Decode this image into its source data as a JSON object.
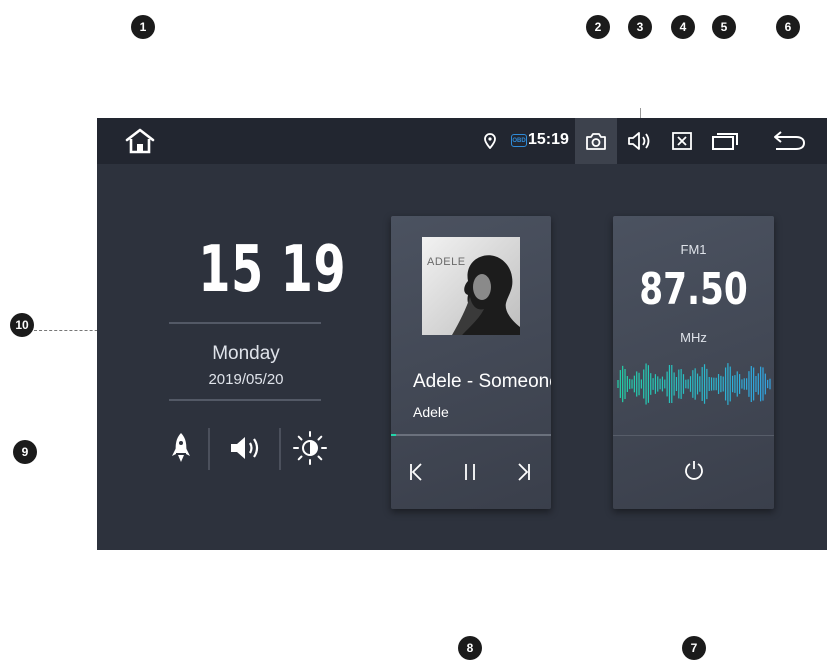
{
  "callouts": [
    "1",
    "2",
    "3",
    "4",
    "5",
    "6",
    "7",
    "8",
    "9",
    "10"
  ],
  "statusbar": {
    "home_icon": "home-icon",
    "location_icon": "location-pin-icon",
    "obd_badge": "OBD",
    "time": "15:19",
    "camera_icon": "camera-icon",
    "volume_icon": "volume-icon",
    "close_icon": "close-icon",
    "recent_apps_icon": "recent-apps-icon",
    "back_icon": "back-icon"
  },
  "clock": {
    "time": "15 19",
    "day": "Monday",
    "date": "2019/05/20"
  },
  "quick_buttons": [
    "rocket-icon",
    "speaker-icon",
    "brightness-icon"
  ],
  "music": {
    "album_art_text": "ADELE",
    "song": "Adele - Someone Like You",
    "artist": "Adele",
    "progress": 0.03,
    "controls": [
      "previous-icon",
      "pause-icon",
      "next-icon"
    ]
  },
  "radio": {
    "band": "FM1",
    "frequency": "87.50",
    "unit": "MHz",
    "power_icon": "power-icon"
  },
  "colors": {
    "screen_bg": "#2d323d",
    "statusbar_bg": "#222630",
    "accent_teal": "#23d3a9",
    "obd_blue": "#2f8bd8"
  }
}
